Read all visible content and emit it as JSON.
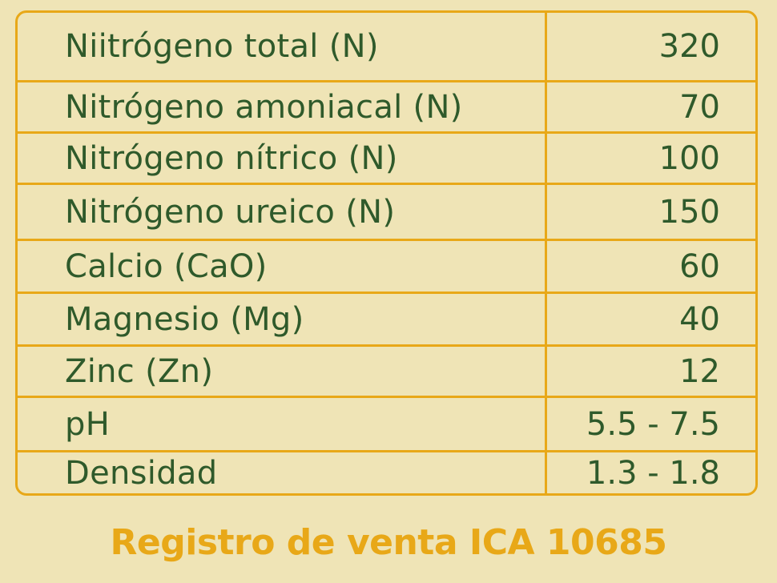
{
  "table": {
    "rows": [
      {
        "label": "Niitrógeno total (N)",
        "value": "320"
      },
      {
        "label": "Nitrógeno amoniacal (N)",
        "value": "70"
      },
      {
        "label": "Nitrógeno nítrico (N)",
        "value": "100"
      },
      {
        "label": "Nitrógeno ureico (N)",
        "value": "150"
      },
      {
        "label": "Calcio (CaO)",
        "value": "60"
      },
      {
        "label": "Magnesio (Mg)",
        "value": "40"
      },
      {
        "label": "Zinc (Zn)",
        "value": "12"
      },
      {
        "label": "pH",
        "value": "5.5 - 7.5"
      },
      {
        "label": "Densidad",
        "value": "1.3 - 1.8"
      }
    ]
  },
  "footer": {
    "text": "Registro de venta ICA 10685"
  },
  "colors": {
    "background": "#efe4b6",
    "border": "#e8a818",
    "text": "#2f5a2b",
    "footer": "#e8a818"
  }
}
